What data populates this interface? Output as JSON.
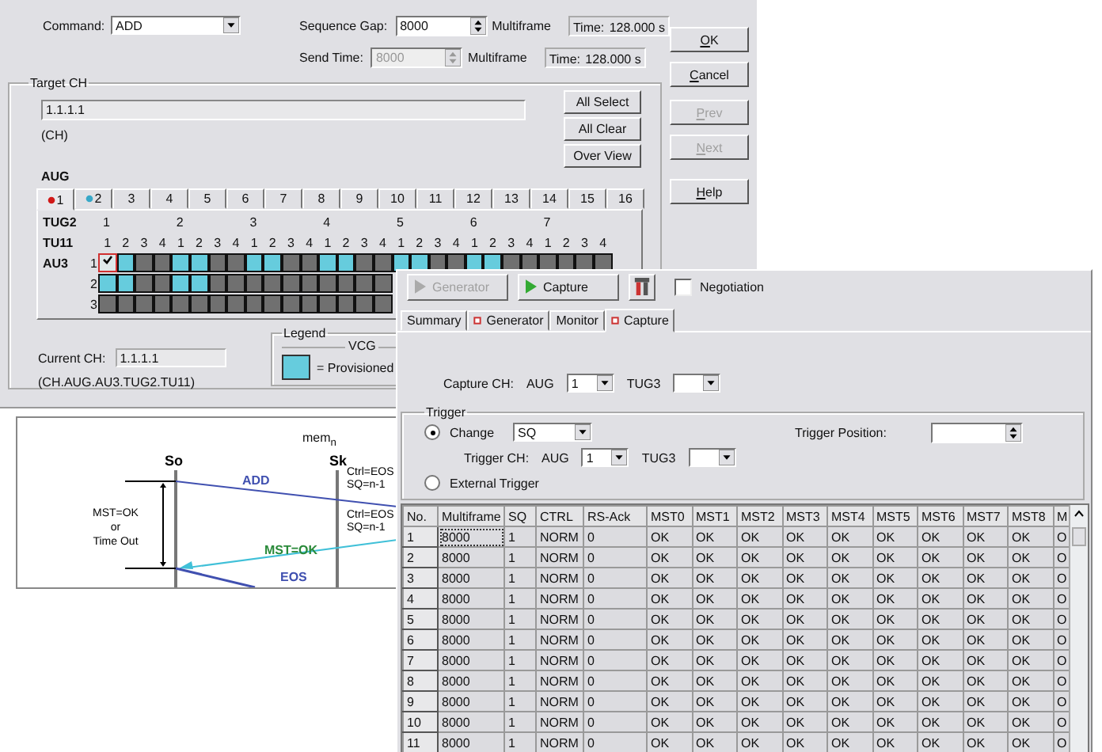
{
  "dialog": {
    "command": {
      "label": "Command:",
      "value": "ADD"
    },
    "sequence_gap": {
      "label": "Sequence Gap:",
      "value": "8000",
      "disabled": false,
      "unit": "Multiframe",
      "time_label": "Time:",
      "time_value": "128.000 s"
    },
    "send_time": {
      "label": "Send Time:",
      "value": "8000",
      "disabled": true,
      "unit": "Multiframe",
      "time_label": "Time:",
      "time_value": "128.000 s"
    },
    "buttons": [
      {
        "label": "OK",
        "disabled": false
      },
      {
        "label": "Cancel",
        "disabled": false
      },
      {
        "label": "Prev",
        "disabled": true
      },
      {
        "label": "Next",
        "disabled": true
      },
      {
        "label": "Help",
        "disabled": false
      }
    ],
    "target_ch": {
      "title": "Target CH",
      "value": "1.1.1.1",
      "hint": "(CH)",
      "buttons": [
        "All Select",
        "All Clear",
        "Over View"
      ],
      "aug_label": "AUG",
      "aug_tabs": [
        {
          "label": "1",
          "selected": true,
          "color": "#d01818"
        },
        {
          "label": "2",
          "selected": false,
          "color": "#38a8c8"
        },
        {
          "label": "3",
          "selected": false
        },
        {
          "label": "4",
          "selected": false
        },
        {
          "label": "5",
          "selected": false
        },
        {
          "label": "6",
          "selected": false
        },
        {
          "label": "7",
          "selected": false
        },
        {
          "label": "8",
          "selected": false
        },
        {
          "label": "9",
          "selected": false
        },
        {
          "label": "10",
          "selected": false
        },
        {
          "label": "11",
          "selected": false
        },
        {
          "label": "12",
          "selected": false
        },
        {
          "label": "13",
          "selected": false
        },
        {
          "label": "14",
          "selected": false
        },
        {
          "label": "15",
          "selected": false
        },
        {
          "label": "16",
          "selected": false
        }
      ],
      "tug2_label": "TUG2",
      "tu11_label": "TU11",
      "au3_label": "AU3",
      "tug2_groups": [
        {
          "label": "1",
          "tu11": [
            "1",
            "2",
            "3",
            "4"
          ]
        },
        {
          "label": "2",
          "tu11": [
            "1",
            "2",
            "3",
            "4"
          ]
        },
        {
          "label": "3",
          "tu11": [
            "1",
            "2",
            "3",
            "4"
          ]
        },
        {
          "label": "4",
          "tu11": [
            "1",
            "2",
            "3",
            "4"
          ]
        },
        {
          "label": "5",
          "tu11": [
            "1",
            "2",
            "3",
            "4"
          ]
        },
        {
          "label": "6",
          "tu11": [
            "1",
            "2",
            "3",
            "4"
          ]
        },
        {
          "label": "7",
          "tu11": [
            "1",
            "2",
            "3",
            "4"
          ]
        }
      ],
      "au3_rows": [
        {
          "label": "1",
          "cells": [
            {
              "provisioned": true,
              "checked": true
            },
            {
              "provisioned": true,
              "checked": false
            },
            {
              "provisioned": false,
              "checked": false
            },
            {
              "provisioned": false,
              "checked": false
            },
            {
              "provisioned": true,
              "checked": false
            },
            {
              "provisioned": true,
              "checked": false
            },
            {
              "provisioned": false,
              "checked": false
            },
            {
              "provisioned": false,
              "checked": false
            },
            {
              "provisioned": true,
              "checked": false
            },
            {
              "provisioned": true,
              "checked": false
            },
            {
              "provisioned": false,
              "checked": false
            },
            {
              "provisioned": false,
              "checked": false
            },
            {
              "provisioned": true,
              "checked": false
            },
            {
              "provisioned": true,
              "checked": false
            },
            {
              "provisioned": false,
              "checked": false
            },
            {
              "provisioned": false,
              "checked": false
            },
            {
              "provisioned": true,
              "checked": false
            },
            {
              "provisioned": true,
              "checked": false
            },
            {
              "provisioned": false,
              "checked": false
            },
            {
              "provisioned": false,
              "checked": false
            },
            {
              "provisioned": true,
              "checked": false
            },
            {
              "provisioned": true,
              "checked": false
            },
            {
              "provisioned": false,
              "checked": false
            },
            {
              "provisioned": false,
              "checked": false
            },
            {
              "provisioned": false,
              "checked": false
            },
            {
              "provisioned": false,
              "checked": false
            },
            {
              "provisioned": false,
              "checked": false
            },
            {
              "provisioned": false,
              "checked": false
            }
          ]
        },
        {
          "label": "2",
          "cells": [
            {
              "provisioned": true,
              "checked": false
            },
            {
              "provisioned": true,
              "checked": false
            },
            {
              "provisioned": false,
              "checked": false
            },
            {
              "provisioned": false,
              "checked": false
            },
            {
              "provisioned": true,
              "checked": false
            },
            {
              "provisioned": true,
              "checked": false
            },
            {
              "provisioned": false,
              "checked": false
            },
            {
              "provisioned": false,
              "checked": false
            },
            {
              "provisioned": false,
              "checked": false
            },
            {
              "provisioned": false,
              "checked": false
            },
            {
              "provisioned": false,
              "checked": false
            },
            {
              "provisioned": false,
              "checked": false
            },
            {
              "provisioned": false,
              "checked": false
            },
            {
              "provisioned": false,
              "checked": false
            },
            {
              "provisioned": false,
              "checked": false
            },
            {
              "provisioned": false,
              "checked": false
            }
          ]
        },
        {
          "label": "3",
          "cells": [
            {
              "provisioned": false,
              "checked": false
            },
            {
              "provisioned": false,
              "checked": false
            },
            {
              "provisioned": false,
              "checked": false
            },
            {
              "provisioned": false,
              "checked": false
            },
            {
              "provisioned": false,
              "checked": false
            },
            {
              "provisioned": false,
              "checked": false
            },
            {
              "provisioned": false,
              "checked": false
            },
            {
              "provisioned": false,
              "checked": false
            },
            {
              "provisioned": false,
              "checked": false
            },
            {
              "provisioned": false,
              "checked": false
            },
            {
              "provisioned": false,
              "checked": false
            },
            {
              "provisioned": false,
              "checked": false
            },
            {
              "provisioned": false,
              "checked": false
            },
            {
              "provisioned": false,
              "checked": false
            },
            {
              "provisioned": false,
              "checked": false
            },
            {
              "provisioned": false,
              "checked": false
            }
          ]
        }
      ],
      "current_ch": {
        "label": "Current CH:",
        "value": "1.1.1.1",
        "hint": "(CH.AUG.AU3.TUG2.TU11)"
      },
      "legend": {
        "title": "Legend",
        "group": "VCG",
        "items": [
          {
            "label": "= Provisioned",
            "color": "#66ccdd"
          }
        ]
      }
    }
  },
  "diagram": {
    "top_label": "mem$_{n}$",
    "source": "So",
    "sink": "Sk",
    "add": "ADD",
    "mst_ok": "MST=OK",
    "eos": "EOS",
    "interval": [
      "MST=OK",
      "or",
      "Time Out"
    ],
    "sink_notes": [
      [
        "Ctrl=EOS",
        "SQ=n-1"
      ],
      [
        "Ctrl=EOS",
        "SQ=n-1"
      ]
    ]
  },
  "capture_window": {
    "toolbar": [
      {
        "label": "Generator",
        "disabled": true
      },
      {
        "label": "Capture",
        "disabled": false
      }
    ],
    "negotiation": {
      "label": "Negotiation",
      "checked": false
    },
    "tabs": [
      {
        "label": "Summary",
        "selected": false,
        "marked": false
      },
      {
        "label": "Generator",
        "selected": false,
        "marked": true
      },
      {
        "label": "Monitor",
        "selected": false,
        "marked": false
      },
      {
        "label": "Capture",
        "selected": true,
        "marked": true
      }
    ],
    "capture_ch": {
      "label": "Capture CH:",
      "aug_label": "AUG",
      "aug_value": "1",
      "tug3_label": "TUG3"
    },
    "trigger": {
      "title": "Trigger",
      "options": [
        {
          "label": "Change",
          "selected": true
        },
        {
          "label": "External Trigger",
          "selected": false
        }
      ],
      "change_value": "SQ",
      "position_label": "Trigger Position:",
      "ch_label": "Trigger CH:",
      "aug_label": "AUG",
      "aug_value": "1",
      "tug3_label": "TUG3"
    },
    "table": {
      "columns": [
        "No.",
        "Multiframe",
        "SQ",
        "CTRL",
        "RS-Ack",
        "MST0",
        "MST1",
        "MST2",
        "MST3",
        "MST4",
        "MST5",
        "MST6",
        "MST7",
        "MST8",
        "M"
      ],
      "rows": [
        {
          "selected": true,
          "cells": [
            "1",
            "8000",
            "1",
            "NORM",
            "0",
            "OK",
            "OK",
            "OK",
            "OK",
            "OK",
            "OK",
            "OK",
            "OK",
            "OK",
            "O"
          ]
        },
        {
          "selected": false,
          "cells": [
            "2",
            "8000",
            "1",
            "NORM",
            "0",
            "OK",
            "OK",
            "OK",
            "OK",
            "OK",
            "OK",
            "OK",
            "OK",
            "OK",
            "O"
          ]
        },
        {
          "selected": false,
          "cells": [
            "3",
            "8000",
            "1",
            "NORM",
            "0",
            "OK",
            "OK",
            "OK",
            "OK",
            "OK",
            "OK",
            "OK",
            "OK",
            "OK",
            "O"
          ]
        },
        {
          "selected": false,
          "cells": [
            "4",
            "8000",
            "1",
            "NORM",
            "0",
            "OK",
            "OK",
            "OK",
            "OK",
            "OK",
            "OK",
            "OK",
            "OK",
            "OK",
            "O"
          ]
        },
        {
          "selected": false,
          "cells": [
            "5",
            "8000",
            "1",
            "NORM",
            "0",
            "OK",
            "OK",
            "OK",
            "OK",
            "OK",
            "OK",
            "OK",
            "OK",
            "OK",
            "O"
          ]
        },
        {
          "selected": false,
          "cells": [
            "6",
            "8000",
            "1",
            "NORM",
            "0",
            "OK",
            "OK",
            "OK",
            "OK",
            "OK",
            "OK",
            "OK",
            "OK",
            "OK",
            "O"
          ]
        },
        {
          "selected": false,
          "cells": [
            "7",
            "8000",
            "1",
            "NORM",
            "0",
            "OK",
            "OK",
            "OK",
            "OK",
            "OK",
            "OK",
            "OK",
            "OK",
            "OK",
            "O"
          ]
        },
        {
          "selected": false,
          "cells": [
            "8",
            "8000",
            "1",
            "NORM",
            "0",
            "OK",
            "OK",
            "OK",
            "OK",
            "OK",
            "OK",
            "OK",
            "OK",
            "OK",
            "O"
          ]
        },
        {
          "selected": false,
          "cells": [
            "9",
            "8000",
            "1",
            "NORM",
            "0",
            "OK",
            "OK",
            "OK",
            "OK",
            "OK",
            "OK",
            "OK",
            "OK",
            "OK",
            "O"
          ]
        },
        {
          "selected": false,
          "cells": [
            "10",
            "8000",
            "1",
            "NORM",
            "0",
            "OK",
            "OK",
            "OK",
            "OK",
            "OK",
            "OK",
            "OK",
            "OK",
            "OK",
            "O"
          ]
        },
        {
          "selected": false,
          "cells": [
            "11",
            "8000",
            "1",
            "NORM",
            "0",
            "OK",
            "OK",
            "OK",
            "OK",
            "OK",
            "OK",
            "OK",
            "OK",
            "OK",
            "O"
          ]
        }
      ]
    }
  }
}
